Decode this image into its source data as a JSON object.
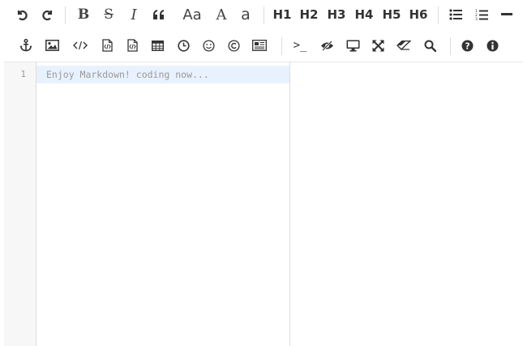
{
  "toolbar": {
    "italic_label": "I",
    "bold_label": "B",
    "strike_label": "S",
    "case_upper_label": "Aa",
    "case_cap_label": "A",
    "case_lower_label": "a",
    "h1": "H1",
    "h2": "H2",
    "h3": "H3",
    "h4": "H4",
    "h5": "H5",
    "h6": "H6",
    "terminal_label": ">_"
  },
  "editor": {
    "line_number": "1",
    "placeholder": "Enjoy Markdown! coding now..."
  },
  "colors": {
    "active_line": "#e8f2ff",
    "icon": "#444444",
    "gutter": "#f7f7f7"
  }
}
